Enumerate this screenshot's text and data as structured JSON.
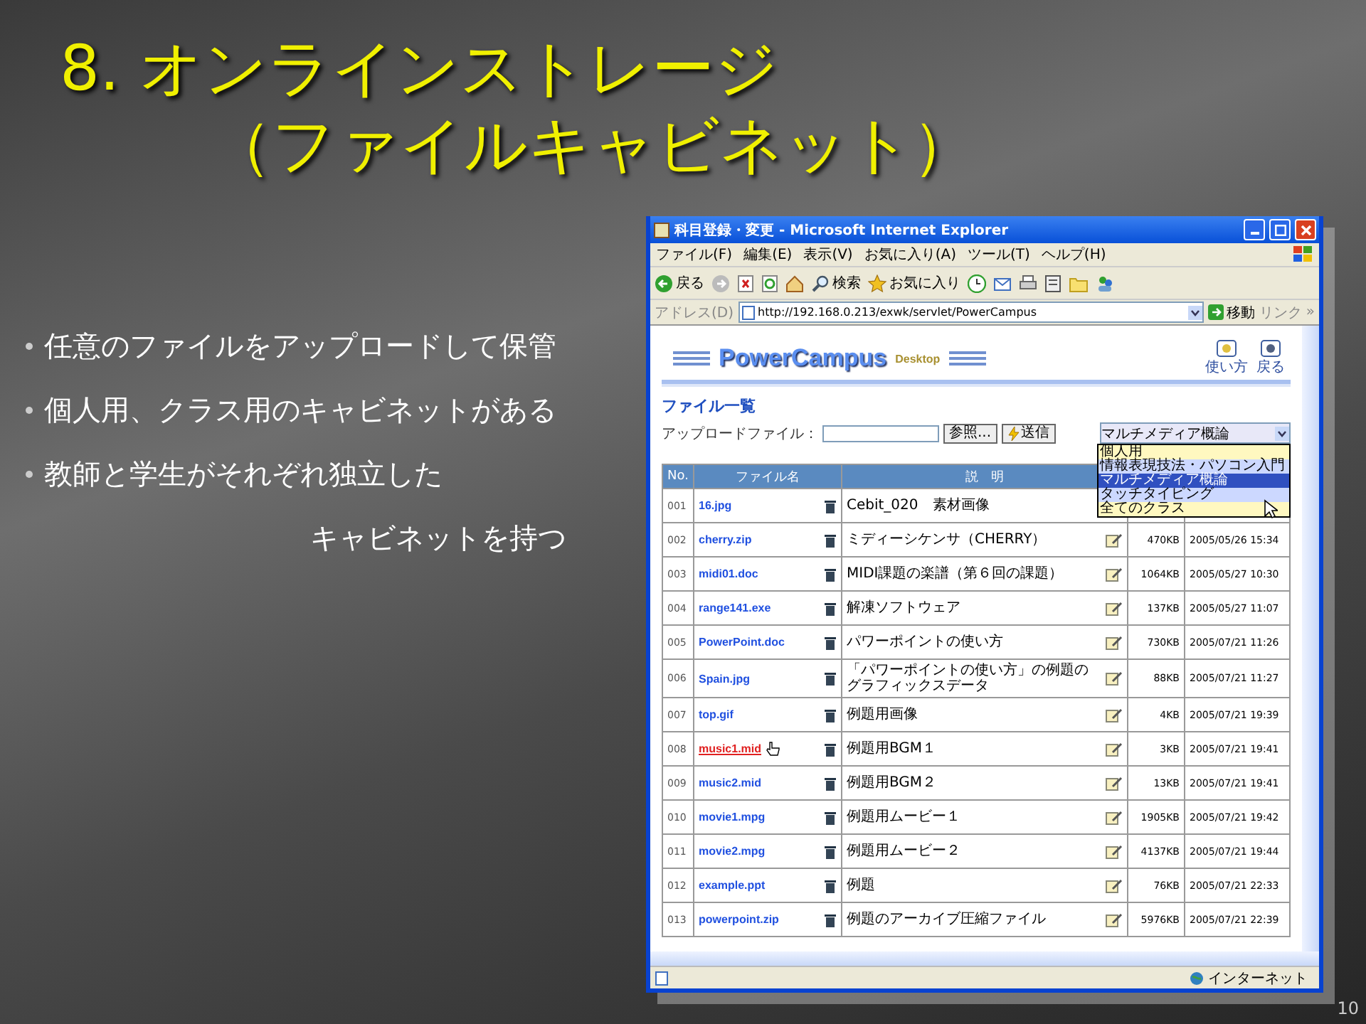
{
  "slide": {
    "title_lines": [
      "8. オンラインストレージ",
      "（ファイルキャビネット）"
    ],
    "bullets": [
      {
        "lines": [
          "任意のファイルをアップロードして保管"
        ]
      },
      {
        "lines": [
          "個人用、クラス用のキャビネットがある"
        ]
      },
      {
        "lines": [
          "教師と学生がそれぞれ独立した",
          "キャビネットを持つ"
        ]
      }
    ],
    "page_number": "10"
  },
  "browser": {
    "title": "科目登録・変更 - Microsoft Internet Explorer",
    "menu": [
      "ファイル(F)",
      "編集(E)",
      "表示(V)",
      "お気に入り(A)",
      "ツール(T)",
      "ヘルプ(H)"
    ],
    "toolbar": {
      "back": "戻る",
      "search": "検索",
      "favorites": "お気に入り"
    },
    "address": {
      "label": "アドレス(D)",
      "url": "http://192.168.0.213/exwk/servlet/PowerCampus",
      "go": "移動",
      "links": "リンク",
      "more": "»"
    },
    "page": {
      "logo": "PowerCampus",
      "logo_sub": "Desktop",
      "header_buttons": [
        {
          "label": "使い方"
        },
        {
          "label": "戻る"
        }
      ],
      "heading": "ファイル一覧",
      "upload": {
        "label": "アップロードファイル：",
        "browse": "参照...",
        "send": "送信"
      },
      "class_select": {
        "value": "マルチメディア概論",
        "expanded": true,
        "options": [
          {
            "label": "個人用",
            "selected": false
          },
          {
            "label": "情報表現技法・パソコン入門",
            "selected": false
          },
          {
            "label": "マルチメディア概論",
            "selected": true
          },
          {
            "label": "タッチタイピング",
            "selected": false
          },
          {
            "label": "全てのクラス",
            "selected": false
          }
        ]
      },
      "table": {
        "columns": [
          "No.",
          "ファイル名",
          "説　明"
        ],
        "rows": [
          {
            "no": "001",
            "file": "16.jpg",
            "hover": false,
            "description": "Cebit_020　素材画像"
          },
          {
            "no": "002",
            "file": "cherry.zip",
            "hover": false,
            "description": "ミディーシケンサ（CHERRY）",
            "size": "470KB",
            "date": "2005/05/26 15:34"
          },
          {
            "no": "003",
            "file": "midi01.doc",
            "hover": false,
            "description": "MIDI課題の楽譜（第６回の課題）",
            "size": "1064KB",
            "date": "2005/05/27 10:30"
          },
          {
            "no": "004",
            "file": "range141.exe",
            "hover": false,
            "description": "解凍ソフトウェア",
            "size": "137KB",
            "date": "2005/05/27 11:07"
          },
          {
            "no": "005",
            "file": "PowerPoint.doc",
            "hover": false,
            "description": "パワーポイントの使い方",
            "size": "730KB",
            "date": "2005/07/21 11:26"
          },
          {
            "no": "006",
            "file": "Spain.jpg",
            "hover": false,
            "description": "「パワーポイントの使い方」の例題のグラフィックスデータ",
            "size": "88KB",
            "date": "2005/07/21 11:27"
          },
          {
            "no": "007",
            "file": "top.gif",
            "hover": false,
            "description": "例題用画像",
            "size": "4KB",
            "date": "2005/07/21 19:39"
          },
          {
            "no": "008",
            "file": "music1.mid",
            "hover": true,
            "description": "例題用BGM１",
            "size": "3KB",
            "date": "2005/07/21 19:41"
          },
          {
            "no": "009",
            "file": "music2.mid",
            "hover": false,
            "description": "例題用BGM２",
            "size": "13KB",
            "date": "2005/07/21 19:41"
          },
          {
            "no": "010",
            "file": "movie1.mpg",
            "hover": false,
            "description": "例題用ムービー１",
            "size": "1905KB",
            "date": "2005/07/21 19:42"
          },
          {
            "no": "011",
            "file": "movie2.mpg",
            "hover": false,
            "description": "例題用ムービー２",
            "size": "4137KB",
            "date": "2005/07/21 19:44"
          },
          {
            "no": "012",
            "file": "example.ppt",
            "hover": false,
            "description": "例題",
            "size": "76KB",
            "date": "2005/07/21 22:33"
          },
          {
            "no": "013",
            "file": "powerpoint.zip",
            "hover": false,
            "description": "例題のアーカイブ圧縮ファイル",
            "size": "5976KB",
            "date": "2005/07/21 22:39"
          }
        ]
      }
    },
    "status": {
      "zone": "インターネット"
    }
  }
}
